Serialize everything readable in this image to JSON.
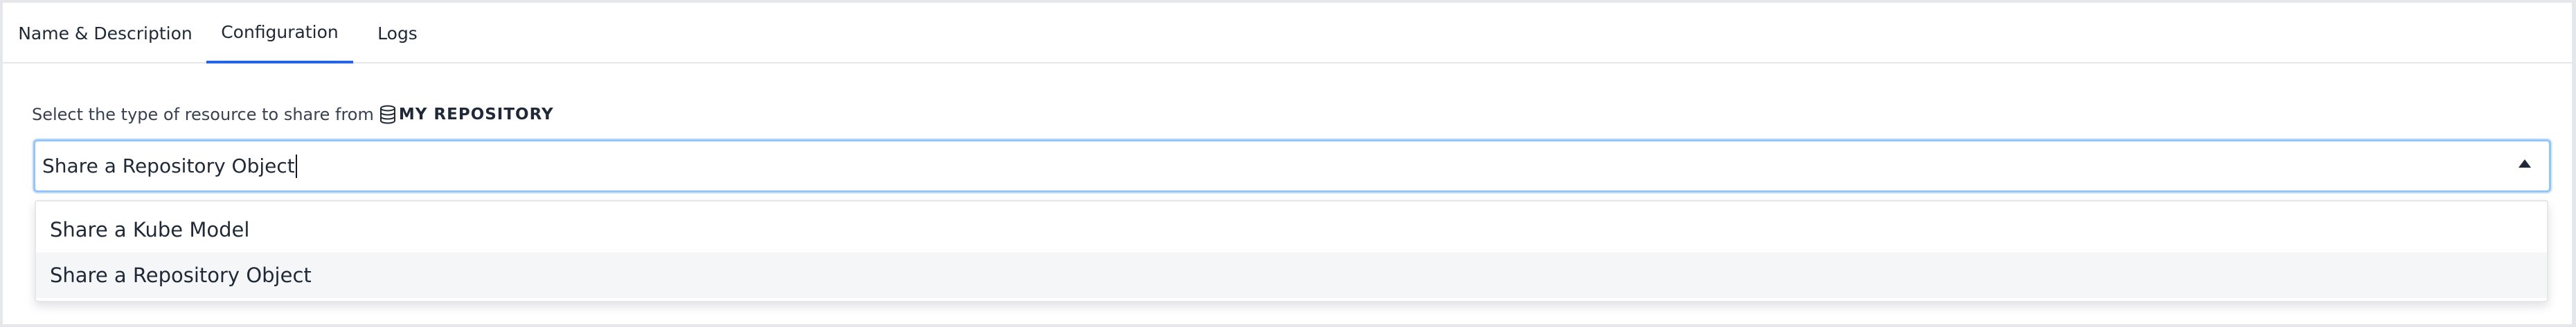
{
  "tabs": [
    {
      "label": "Name & Description",
      "active": false
    },
    {
      "label": "Configuration",
      "active": true
    },
    {
      "label": "Logs",
      "active": false
    }
  ],
  "prompt": {
    "text": "Select the type of resource to share from",
    "icon": "database-icon",
    "repository": "MY REPOSITORY"
  },
  "select": {
    "value": "Share a Repository Object",
    "expanded": true
  },
  "options": [
    {
      "label": "Share a Kube Model",
      "selected": false
    },
    {
      "label": "Share a Repository Object",
      "selected": true
    }
  ],
  "colors": {
    "accent": "#2563eb",
    "focus_border": "#93c5fd",
    "selected_option_bg": "#f5f6f7"
  }
}
